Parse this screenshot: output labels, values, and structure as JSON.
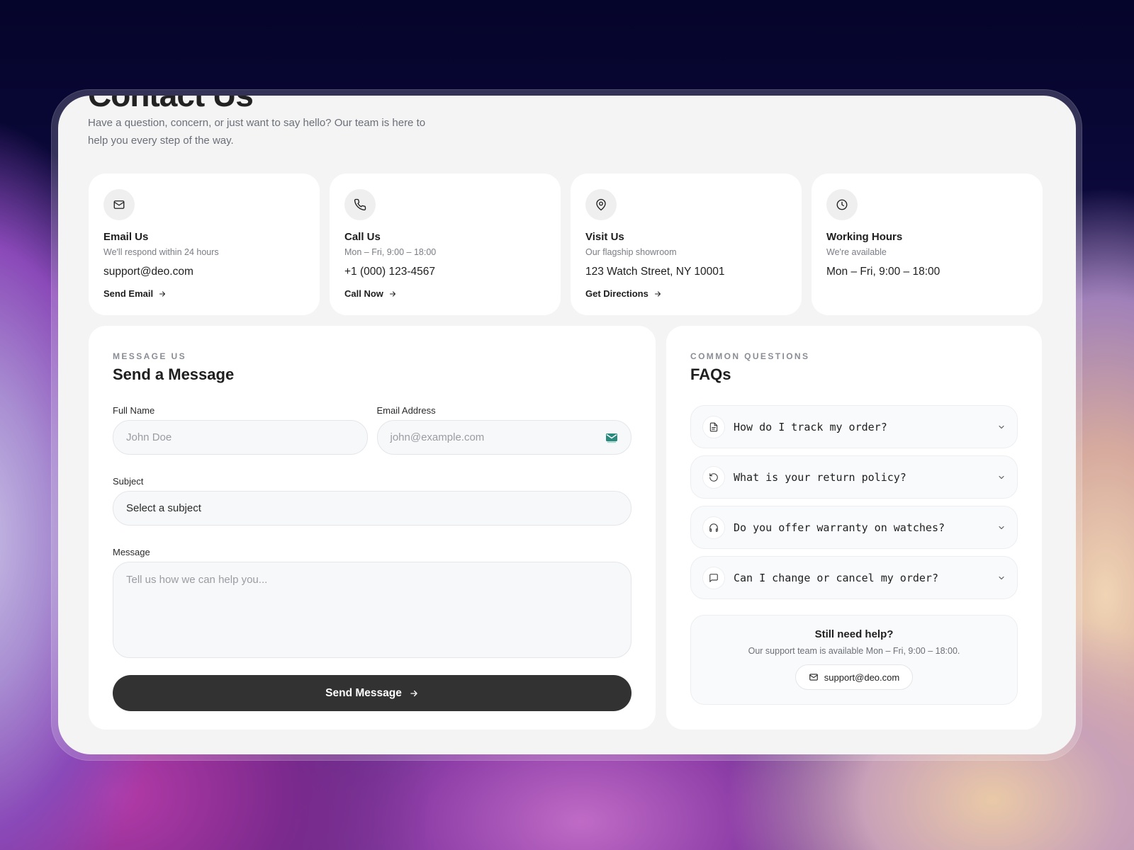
{
  "hero": {
    "title": "Contact Us",
    "subtitle": "Have a question, concern, or just want to say hello? Our team is here to help you every step of the way."
  },
  "cards": [
    {
      "icon": "mail-icon",
      "title": "Email Us",
      "desc": "We'll respond within 24 hours",
      "value": "support@deo.com",
      "link": "Send Email"
    },
    {
      "icon": "phone-icon",
      "title": "Call Us",
      "desc": "Mon – Fri, 9:00 – 18:00",
      "value": "+1 (000) 123-4567",
      "link": "Call Now"
    },
    {
      "icon": "map-pin-icon",
      "title": "Visit Us",
      "desc": "Our flagship showroom",
      "value": "123 Watch Street, NY 10001",
      "link": "Get Directions"
    },
    {
      "icon": "clock-icon",
      "title": "Working Hours",
      "desc": "We're available",
      "value": "Mon – Fri, 9:00 – 18:00",
      "link": ""
    }
  ],
  "form": {
    "eyebrow": "MESSAGE US",
    "title": "Send a Message",
    "full_name_label": "Full Name",
    "full_name_placeholder": "John Doe",
    "email_label": "Email Address",
    "email_placeholder": "john@example.com",
    "subject_label": "Subject",
    "subject_value": "Select a subject",
    "message_label": "Message",
    "message_placeholder": "Tell us how we can help you...",
    "submit_label": "Send Message"
  },
  "faq": {
    "eyebrow": "COMMON QUESTIONS",
    "title": "FAQs",
    "items": [
      {
        "icon": "document-icon",
        "question": "How do I track my order?"
      },
      {
        "icon": "rotate-ccw-icon",
        "question": "What is your return policy?"
      },
      {
        "icon": "headphones-icon",
        "question": "Do you offer warranty on watches?"
      },
      {
        "icon": "message-square-icon",
        "question": "Can I change or cancel my order?"
      }
    ],
    "help": {
      "title": "Still need help?",
      "desc": "Our support team is available Mon – Fri, 9:00 – 18:00.",
      "email": "support@deo.com"
    }
  },
  "colors": {
    "button_dark": "#323232",
    "panel_bg": "#f4f4f4",
    "card_bg": "#ffffff",
    "email_badge": "#2b8a7e"
  }
}
